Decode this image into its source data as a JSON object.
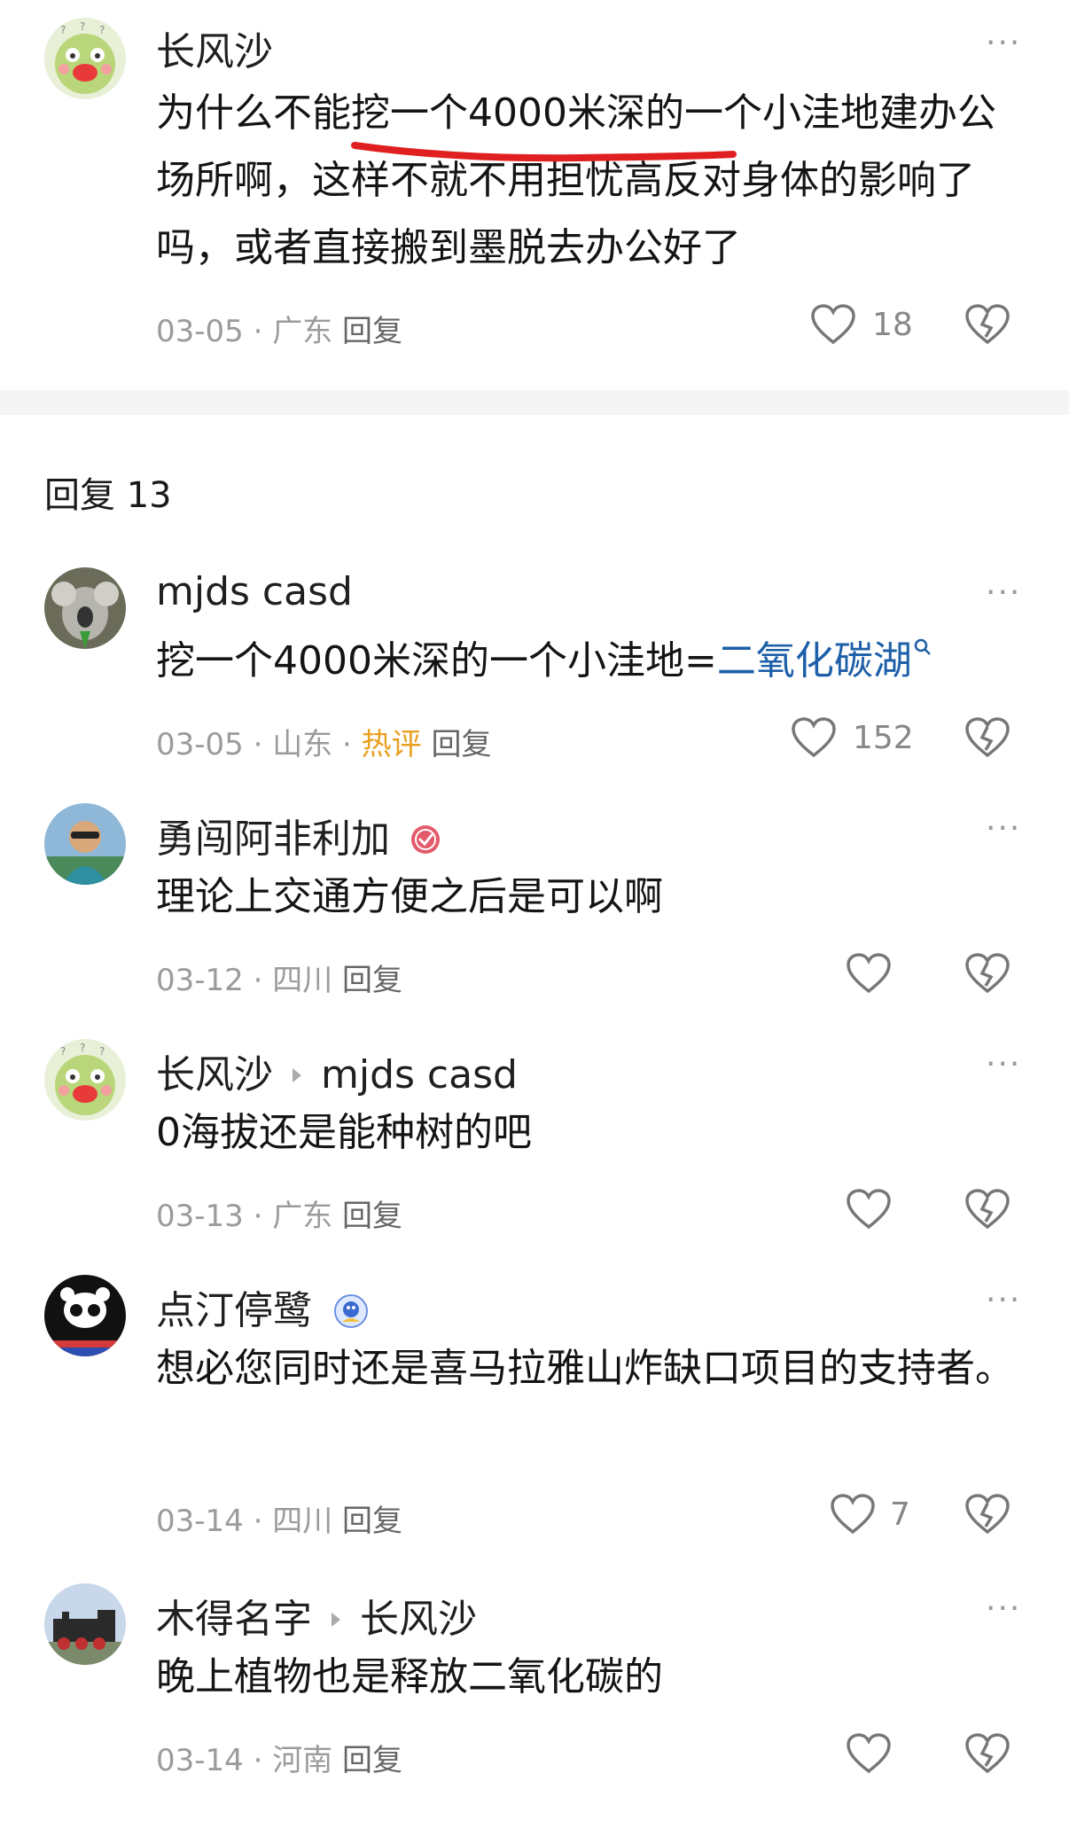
{
  "main_comment": {
    "username": "长风沙",
    "text": "为什么不能挖一个4000米深的一个小洼地建办公场所啊，这样不就不用担忧高反对身体的影响了吗，或者直接搬到墨脱去办公好了",
    "date": "03-05",
    "location": "广东",
    "reply_label": "回复",
    "like_count": "18"
  },
  "replies_header": "回复 13",
  "replies": [
    {
      "username": "mjds casd",
      "text_prefix": "挖一个4000米深的一个小洼地=",
      "link_text": "二氧化碳湖",
      "date": "03-05",
      "location": "山东",
      "hot_label": "热评",
      "reply_label": "回复",
      "like_count": "152"
    },
    {
      "username": "勇闯阿非利加",
      "text": "理论上交通方便之后是可以啊",
      "date": "03-12",
      "location": "四川",
      "reply_label": "回复",
      "like_count": ""
    },
    {
      "username": "长风沙",
      "reply_to": "mjds casd",
      "text": "0海拔还是能种树的吧",
      "date": "03-13",
      "location": "广东",
      "reply_label": "回复",
      "like_count": ""
    },
    {
      "username": "点汀停鹭",
      "text": "想必您同时还是喜马拉雅山炸缺口项目的支持者。",
      "date": "03-14",
      "location": "四川",
      "reply_label": "回复",
      "like_count": "7"
    },
    {
      "username": "木得名字",
      "reply_to": "长风沙",
      "text": "晚上植物也是释放二氧化碳的",
      "date": "03-14",
      "location": "河南",
      "reply_label": "回复",
      "like_count": ""
    }
  ],
  "meta_separator": "·",
  "more_label": "···",
  "colors": {
    "link": "#1d5fa8",
    "hot": "#e8a020",
    "underline": "#e02020"
  }
}
